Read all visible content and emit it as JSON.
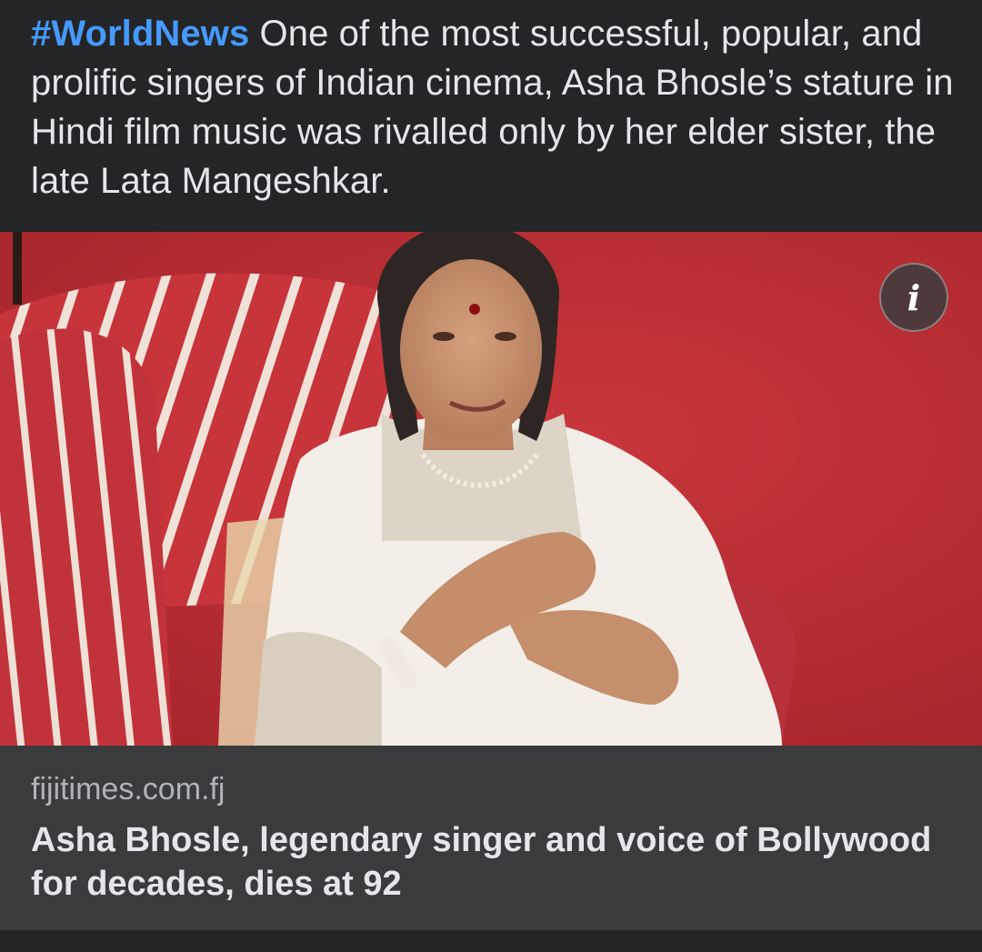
{
  "post": {
    "hashtag": "#WorldNews",
    "body": " One of the most successful, popular, and prolific singers of Indian cinema, Asha Bhosle’s stature in Hindi film music was rivalled only by her elder sister, the late Lata Mangeshkar."
  },
  "media": {
    "info_glyph": "i",
    "info_icon": "info-icon"
  },
  "link_card": {
    "domain": "fijitimes.com.fj",
    "title": "Asha Bhosle, legendary singer and voice of Bollywood for decades, dies at 92"
  },
  "colors": {
    "background": "#242526",
    "card": "#3a3b3c",
    "hashtag": "#4599ff",
    "text": "#e4e6eb",
    "muted": "#b0b3b8"
  }
}
